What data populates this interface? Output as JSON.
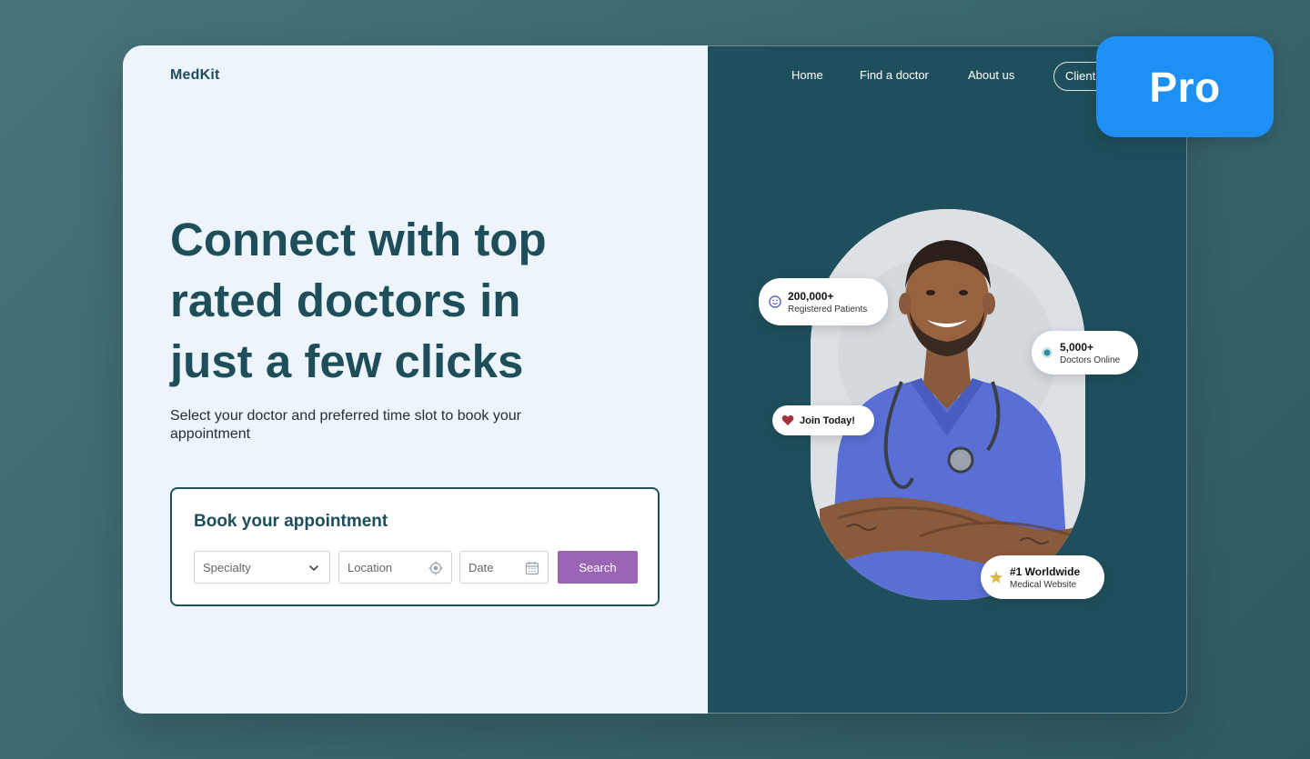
{
  "brand": {
    "name": "MedKit"
  },
  "nav": {
    "items": [
      "Home",
      "Find a doctor",
      "About us"
    ],
    "client_button": "Client"
  },
  "hero": {
    "headline_lines": [
      "Connect with top",
      "rated doctors in",
      "just a few clicks"
    ],
    "subtitle": "Select your doctor and preferred time slot to book your appointment"
  },
  "booking": {
    "title": "Book your appointment",
    "specialty_placeholder": "Specialty",
    "location_placeholder": "Location",
    "date_placeholder": "Date",
    "search_label": "Search"
  },
  "stats": {
    "patients": {
      "value": "200,000+",
      "label": "Registered Patients",
      "icon": "smiley-icon"
    },
    "doctors": {
      "value": "5,000+",
      "label": "Doctors Online",
      "icon": "online-dot-icon"
    },
    "join": {
      "label": "Join Today!",
      "icon": "heart-icon"
    },
    "worldwide": {
      "value": "#1 Worldwide",
      "label": "Medical Website",
      "icon": "star-icon"
    }
  },
  "badge": {
    "label": "Pro"
  },
  "colors": {
    "background": "#3b6870",
    "panel_light": "#edf4fb",
    "panel_dark": "#1f4f5c",
    "headline": "#1d4e59",
    "search_button": "#9b65b6",
    "pro_badge": "#1e8ff5"
  }
}
